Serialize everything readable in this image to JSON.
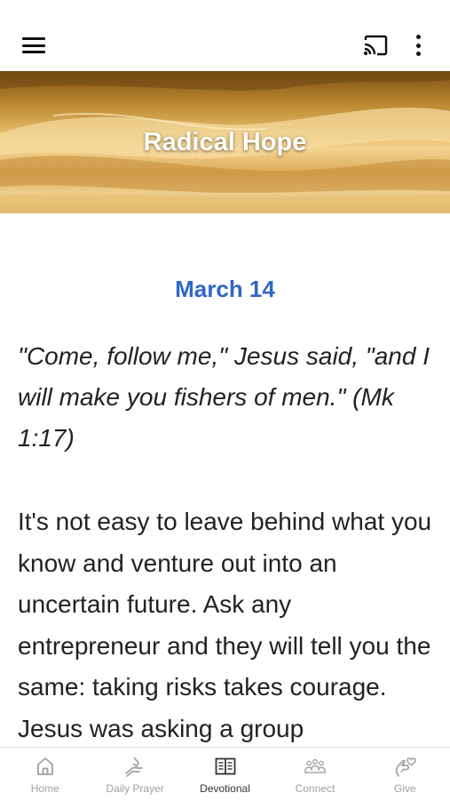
{
  "header": {
    "menu_icon": "hamburger-menu-icon",
    "cast_icon": "cast-icon",
    "more_icon": "more-vert-icon"
  },
  "banner": {
    "title": "Radical Hope"
  },
  "devotional": {
    "date": "March 14",
    "verse": "\"Come, follow me,\" Jesus said, \"and I will make you fishers of men.\" (Mk 1:17)",
    "body": "It's not easy to leave behind what you know and venture out into an uncertain future. Ask any entrepreneur and they will tell you the same: taking risks takes courage. Jesus was asking a group"
  },
  "tabs": [
    {
      "label": "Home",
      "icon": "home-icon",
      "active": false
    },
    {
      "label": "Daily Prayer",
      "icon": "praying-hands-icon",
      "active": false
    },
    {
      "label": "Devotional",
      "icon": "book-icon",
      "active": true
    },
    {
      "label": "Connect",
      "icon": "people-icon",
      "active": false
    },
    {
      "label": "Give",
      "icon": "give-icon",
      "active": false
    }
  ],
  "colors": {
    "accent": "#2f67c4",
    "tab_active": "#333333",
    "tab_inactive": "#a0a0a0"
  }
}
